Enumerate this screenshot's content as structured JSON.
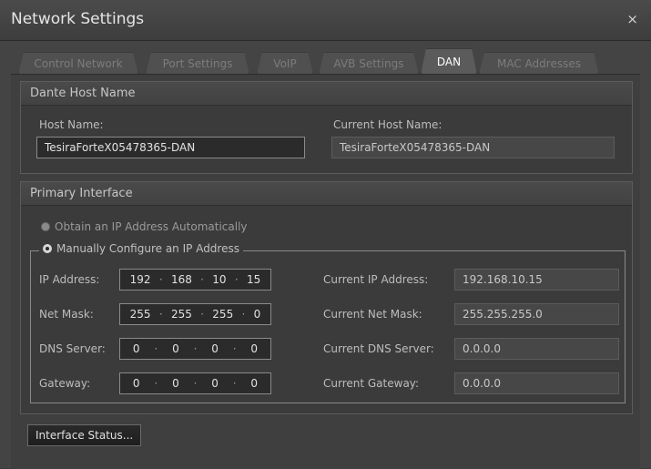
{
  "window": {
    "title": "Network Settings",
    "close_glyph": "×"
  },
  "tabs": [
    {
      "label": "Control Network"
    },
    {
      "label": "Port Settings"
    },
    {
      "label": "VoIP"
    },
    {
      "label": "AVB Settings"
    },
    {
      "label": "DAN",
      "active": true
    },
    {
      "label": "MAC Addresses"
    }
  ],
  "dante": {
    "heading": "Dante Host Name",
    "host_label": "Host Name:",
    "host_value": "TesiraForteX05478365-DAN",
    "current_label": "Current Host Name:",
    "current_value": "TesiraForteX05478365-DAN"
  },
  "primary": {
    "heading": "Primary Interface",
    "auto_label": "Obtain an IP Address Automatically",
    "manual_label": "Manually Configure an IP Address",
    "selected": "manual",
    "rows": [
      {
        "label": "IP Address:",
        "octets": [
          "192",
          "168",
          "10",
          "15"
        ],
        "current_label": "Current IP Address:",
        "current_value": "192.168.10.15"
      },
      {
        "label": "Net Mask:",
        "octets": [
          "255",
          "255",
          "255",
          "0"
        ],
        "current_label": "Current Net Mask:",
        "current_value": "255.255.255.0"
      },
      {
        "label": "DNS Server:",
        "octets": [
          "0",
          "0",
          "0",
          "0"
        ],
        "current_label": "Current DNS Server:",
        "current_value": "0.0.0.0"
      },
      {
        "label": "Gateway:",
        "octets": [
          "0",
          "0",
          "0",
          "0"
        ],
        "current_label": "Current Gateway:",
        "current_value": "0.0.0.0"
      }
    ],
    "separator": "·"
  },
  "actions": {
    "interface_status_label": "Interface Status..."
  },
  "colors": {
    "window_bg": "#444444",
    "active_tab_text": "#ffffff",
    "field_border": "#8a8a8a"
  }
}
